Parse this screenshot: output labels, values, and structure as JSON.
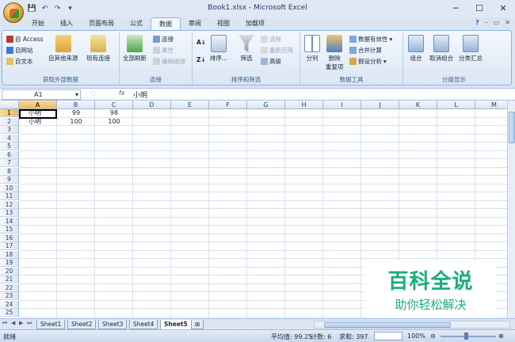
{
  "window": {
    "title": "Book1.xlsx - Microsoft Excel",
    "minimize": "─",
    "maximize": "☐",
    "close": "✕"
  },
  "qat": [
    "💾",
    "↶",
    "↷",
    "▾"
  ],
  "tabs": [
    "开始",
    "插入",
    "页面布局",
    "公式",
    "数据",
    "审阅",
    "视图",
    "加载项"
  ],
  "active_tab": "数据",
  "ribbon_right": [
    "?",
    "–",
    "▭",
    "✕"
  ],
  "ribbon": {
    "get_external": {
      "label": "获取外部数据",
      "access": "自 Access",
      "web": "自网站",
      "text": "自文本",
      "other": "自其他来源",
      "existing": "现有连接"
    },
    "connections": {
      "label": "连接",
      "refresh_all": "全部刷新",
      "connections": "连接",
      "properties": "属性",
      "edit_links": "编辑链接"
    },
    "sort_filter": {
      "label": "排序和筛选",
      "sort": "排序...",
      "filter": "筛选",
      "clear": "清除",
      "reapply": "重新应用",
      "advanced": "高级"
    },
    "data_tools": {
      "label": "数据工具",
      "text_to_columns": "分列",
      "remove_dup_1": "删除",
      "remove_dup_2": "重复项",
      "validation": "数据有效性",
      "consolidate": "合并计算",
      "whatif": "假设分析"
    },
    "outline": {
      "label": "分级显示",
      "group": "组合",
      "ungroup": "取消组合",
      "subtotal": "分类汇总"
    }
  },
  "formula_bar": {
    "name_box": "A1",
    "fx": "fx",
    "value": "小明"
  },
  "columns": [
    "A",
    "B",
    "C",
    "D",
    "E",
    "F",
    "G",
    "H",
    "I",
    "J",
    "K",
    "L",
    "M"
  ],
  "rows": [
    "1",
    "2",
    "3",
    "4",
    "5",
    "6",
    "7",
    "8",
    "9",
    "10",
    "11",
    "12",
    "13",
    "14",
    "15",
    "16",
    "17",
    "18",
    "19",
    "20",
    "21",
    "22",
    "23",
    "24",
    "25"
  ],
  "cells": [
    {
      "row": 0,
      "col": 0,
      "value": "小明",
      "align": "left"
    },
    {
      "row": 0,
      "col": 1,
      "value": "99",
      "align": "center"
    },
    {
      "row": 0,
      "col": 2,
      "value": "98",
      "align": "center"
    },
    {
      "row": 1,
      "col": 0,
      "value": "小明",
      "align": "left"
    },
    {
      "row": 1,
      "col": 1,
      "value": "100",
      "align": "center"
    },
    {
      "row": 1,
      "col": 2,
      "value": "100",
      "align": "center"
    }
  ],
  "sheets": [
    "Sheet1",
    "Sheet2",
    "Sheet3",
    "Sheet4",
    "Sheet5"
  ],
  "active_sheet": "Sheet5",
  "status": {
    "ready": "就绪",
    "average": "平均值: 99.25",
    "count": "计数: 6",
    "sum": "求和: 397",
    "zoom": "100%"
  },
  "watermark": {
    "title": "百科全说",
    "subtitle": "助你轻松解决"
  }
}
